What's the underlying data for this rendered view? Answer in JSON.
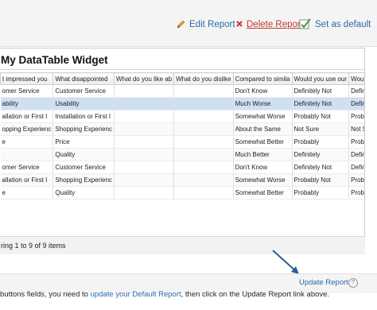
{
  "toolbar": {
    "edit_label": "Edit Report",
    "delete_label": "Delete Report",
    "set_default_label": "Set as default"
  },
  "widget": {
    "title": "My DataTable Widget",
    "columns": [
      "t impressed you",
      "What disappointed",
      "What do you like ab",
      "What do you dislike",
      "Compared to simila",
      "Would you use our",
      "Would you reco"
    ],
    "rows": [
      [
        "omer Service",
        "Customer Service",
        "",
        "",
        "Don't Know",
        "Definitely Not",
        "Definitely Not"
      ],
      [
        "ability",
        "Usability",
        "",
        "",
        "Much Worse",
        "Definitely Not",
        "Definitely Not"
      ],
      [
        "allation or First I",
        "Installation or First I",
        "",
        "",
        "Somewhat Worse",
        "Probably Not",
        "Probably Not"
      ],
      [
        "opping Experienc",
        "Shopping Experienc",
        "",
        "",
        "About the Same",
        "Not Sure",
        "Not Sure"
      ],
      [
        "e",
        "Price",
        "",
        "",
        "Somewhat Better",
        "Probably",
        "Probably"
      ],
      [
        "",
        "Quality",
        "",
        "",
        "Much Better",
        "Definitely",
        "Definitely"
      ],
      [
        "omer Service",
        "Customer Service",
        "",
        "",
        "Don't Know",
        "Definitely Not",
        "Definitely Not"
      ],
      [
        "allation or First I",
        "Shopping Experienc",
        "",
        "",
        "Somewhat Worse",
        "Probably Not",
        "Probably Not"
      ],
      [
        "e",
        "Quality",
        "",
        "",
        "Somewhat Better",
        "Probably",
        "Probably"
      ]
    ],
    "selected_row": 1,
    "pager_text": "ring 1 to 9 of 9 items"
  },
  "footer": {
    "hint_prefix": "buttons fields, you need to ",
    "hint_link": "update your Default Report",
    "hint_suffix": ", then click on the Update Report link above.",
    "update_label": "Update Report",
    "help_glyph": "?"
  },
  "colors": {
    "link": "#2a6aa8",
    "delete": "#c0392b",
    "selected_row": "#cfe0f3",
    "arrow": "#2b5f9e"
  },
  "icons": [
    "pencil-icon",
    "delete-x-icon",
    "set-default-icon",
    "help-icon",
    "scroll-right-arrow-icon"
  ]
}
